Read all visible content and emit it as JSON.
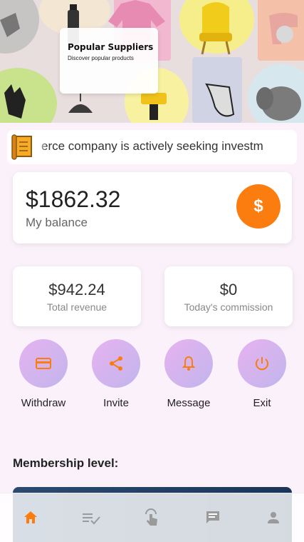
{
  "banner": {
    "card_title": "Popular Suppliers",
    "card_subtitle": "Discover popular products"
  },
  "ticker": {
    "text": "erce company is actively seeking investm"
  },
  "balance": {
    "amount": "$1862.32",
    "label": "My balance",
    "button_symbol": "$"
  },
  "stats": [
    {
      "value": "$942.24",
      "label": "Total revenue"
    },
    {
      "value": "$0",
      "label": "Today's commission"
    }
  ],
  "actions": [
    {
      "label": "Withdraw",
      "icon": "card-icon"
    },
    {
      "label": "Invite",
      "icon": "share-icon"
    },
    {
      "label": "Message",
      "icon": "bell-icon"
    },
    {
      "label": "Exit",
      "icon": "power-icon"
    }
  ],
  "membership": {
    "heading": "Membership level:"
  },
  "tabbar": {
    "items": [
      "home-icon",
      "task-list-icon",
      "tap-icon",
      "chat-icon",
      "profile-icon"
    ],
    "active_color": "#fb7c0f",
    "inactive_color": "#9a9a9a"
  },
  "colors": {
    "accent": "#fb7c0f",
    "action_gradient_start": "#e6b3f0",
    "action_gradient_end": "#c2b4ec"
  }
}
